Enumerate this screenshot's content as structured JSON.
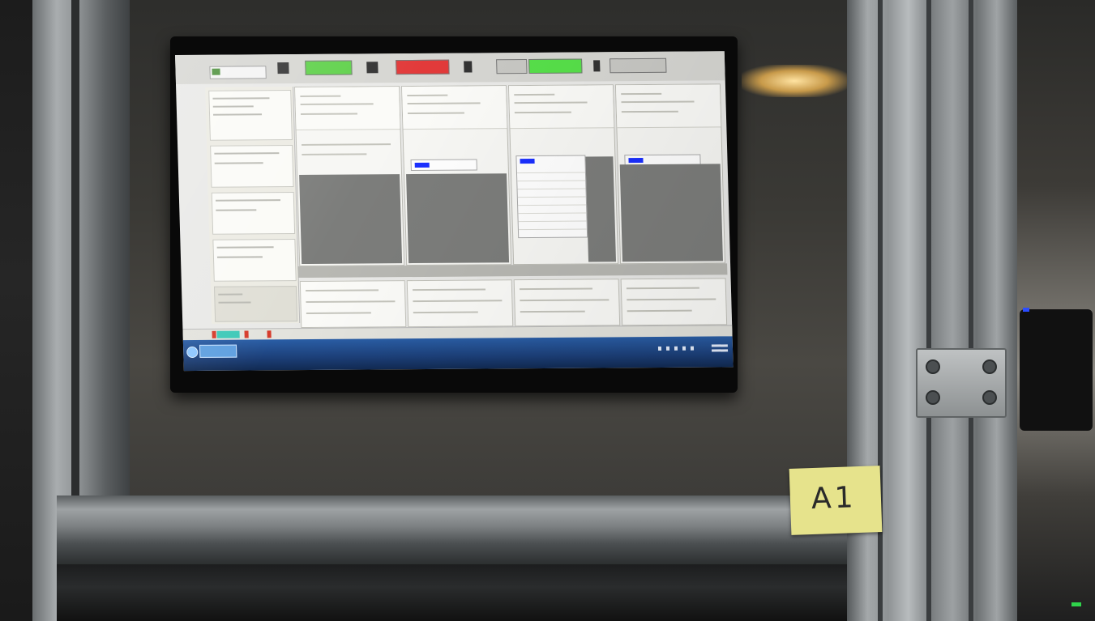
{
  "sticky_note": {
    "label": "A1"
  },
  "screen": {
    "description_icon": "hmi-dashboard",
    "toolbar_indicators": [
      {
        "name": "status-indicator-1",
        "color": "#5fd14a"
      },
      {
        "name": "status-indicator-2",
        "color": "#e23a3a"
      },
      {
        "name": "status-indicator-3",
        "color": "#c8c8c4"
      },
      {
        "name": "status-indicator-4",
        "color": "#57e04a"
      },
      {
        "name": "status-indicator-5",
        "color": "#c8c8c4"
      }
    ],
    "colors": {
      "screen_bg": "#e9e9e7",
      "panel_gray": "#7c7d7b",
      "taskbar": "#1c3f78",
      "selection_marker": "#1a2fff",
      "status_teal": "#3ec9b8"
    }
  }
}
